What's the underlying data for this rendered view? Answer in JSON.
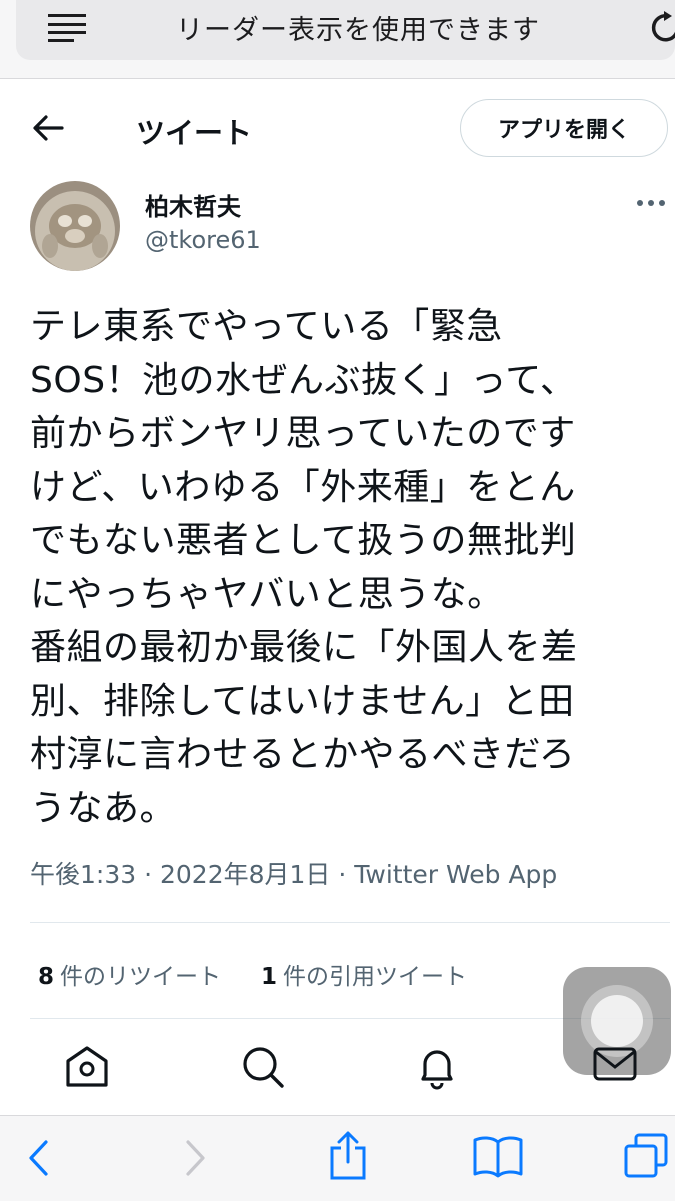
{
  "safari": {
    "reader_text": "リーダー表示を使用できます"
  },
  "header": {
    "title": "ツイート",
    "open_app_label": "アプリを開く"
  },
  "author": {
    "name": "柏木哲夫",
    "handle": "@tkore61"
  },
  "tweet": {
    "text": "テレ東系でやっている「緊急\nSOS！池の水ぜんぶ抜く」って、\n前からボンヤリ思っていたのです\nけど、いわゆる「外来種」をとん\nでもない悪者として扱うの無批判\nにやっちゃヤバいと思うな。\n番組の最初か最後に「外国人を差\n別、排除してはいけません」と田\n村淳に言わせるとかやるべきだろ\nうなあ。",
    "meta": "午後1:33 · 2022年8月1日 · Twitter Web App"
  },
  "stats": {
    "retweets_count": "8",
    "retweets_label": "件のリツイート",
    "quotes_count": "1",
    "quotes_label": "件の引用ツイート"
  },
  "icons": {
    "reader": "reader-view-icon",
    "reload": "reload-icon",
    "back": "back-arrow-icon",
    "more": "more-icon",
    "home": "home-icon",
    "search": "search-icon",
    "notifications": "bell-icon",
    "messages": "mail-icon"
  },
  "colors": {
    "text": "#0f1419",
    "secondary": "#536471",
    "safari_blue": "#0a7aff"
  }
}
